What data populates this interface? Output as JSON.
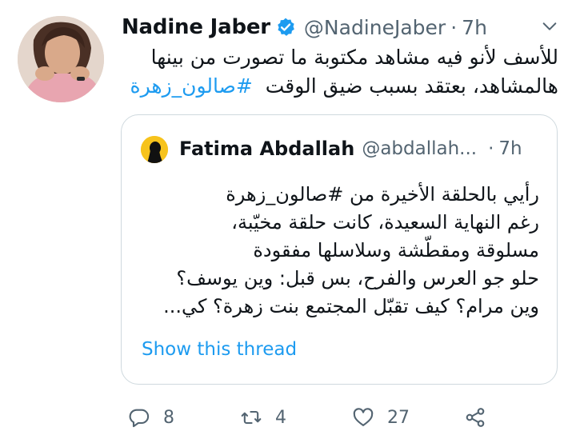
{
  "tweet": {
    "author_name": "Nadine Jaber",
    "author_handle": "@NadineJaber",
    "separator": "·",
    "time": "7h",
    "text_lines": [
      "للأسف لأنو فيه مشاهد مكتوبة ما تصورت من بينها",
      "هالمشاهد، بعتقد بسبب ضيق الوقت"
    ],
    "hashtag": "#صالون_زهرة",
    "icons": {
      "verified": "verified-badge-icon",
      "more": "chevron-down-icon"
    }
  },
  "quote": {
    "author_name": "Fatima Abdallah",
    "author_handle": "@abdallah...",
    "separator": "·",
    "time": "7h",
    "text_lines": [
      "رأيي بالحلقة الأخيرة من #صالون_زهرة",
      "رغم النهاية السعيدة، كانت حلقة مخيّبة،",
      "مسلوقة ومقطّشة وسلاسلها مفقودة",
      "حلو جو العرس والفرح، بس قبل: وين يوسف؟",
      "وين مرام؟ كيف تقبّل المجتمع بنت زهرة؟ كي..."
    ],
    "show_thread": "Show this thread"
  },
  "actions": {
    "reply_count": "8",
    "retweet_count": "4",
    "like_count": "27",
    "icons": [
      "reply-icon",
      "retweet-icon",
      "like-icon",
      "share-icon"
    ]
  },
  "colors": {
    "text": "#0f1419",
    "secondary": "#536471",
    "accent": "#1d9bf0",
    "border": "#cfd9de"
  }
}
